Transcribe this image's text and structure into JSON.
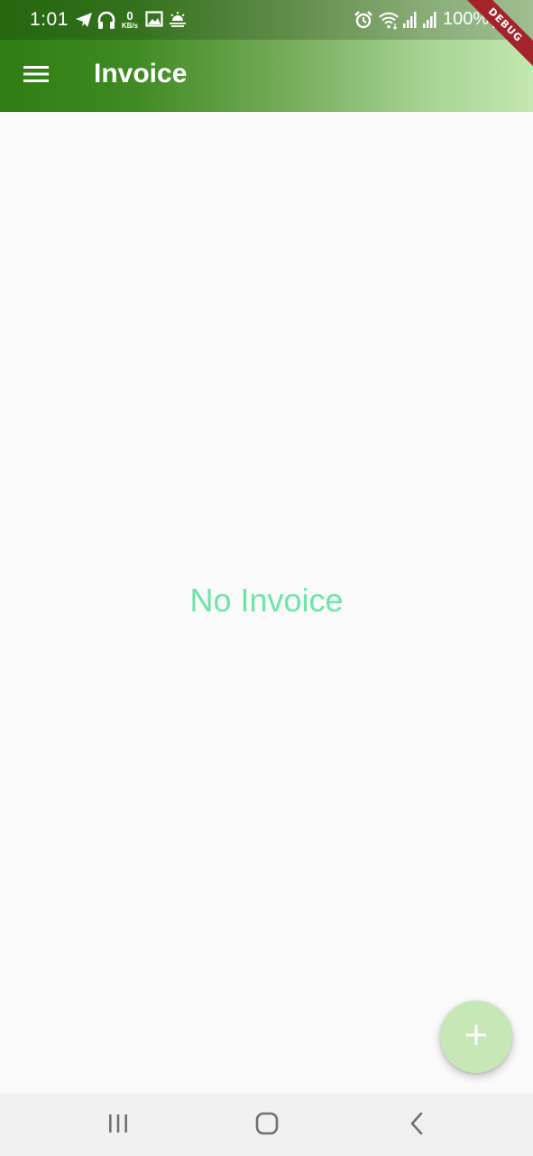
{
  "status_bar": {
    "time": "1:01",
    "network_speed_value": "0",
    "network_speed_unit": "KB/s",
    "battery_percent": "100%",
    "left_icons": [
      "telegram-icon",
      "headphones-icon",
      "gallery-icon",
      "weather-icon"
    ],
    "right_icons": [
      "alarm-icon",
      "wifi-icon",
      "signal-icon",
      "signal-icon",
      "battery-icon"
    ]
  },
  "debug_banner": "DEBUG",
  "app_bar": {
    "title": "Invoice",
    "menu_icon": "menu-icon",
    "gradient": [
      "#2e7d13",
      "#c3e8b1"
    ]
  },
  "main": {
    "empty_message": "No Invoice",
    "empty_color": "#6fe3a8"
  },
  "fab": {
    "icon": "plus-icon",
    "color": "#c5e8b6"
  },
  "nav_bar": {
    "buttons": [
      "recent-apps-icon",
      "home-icon",
      "back-icon"
    ]
  }
}
